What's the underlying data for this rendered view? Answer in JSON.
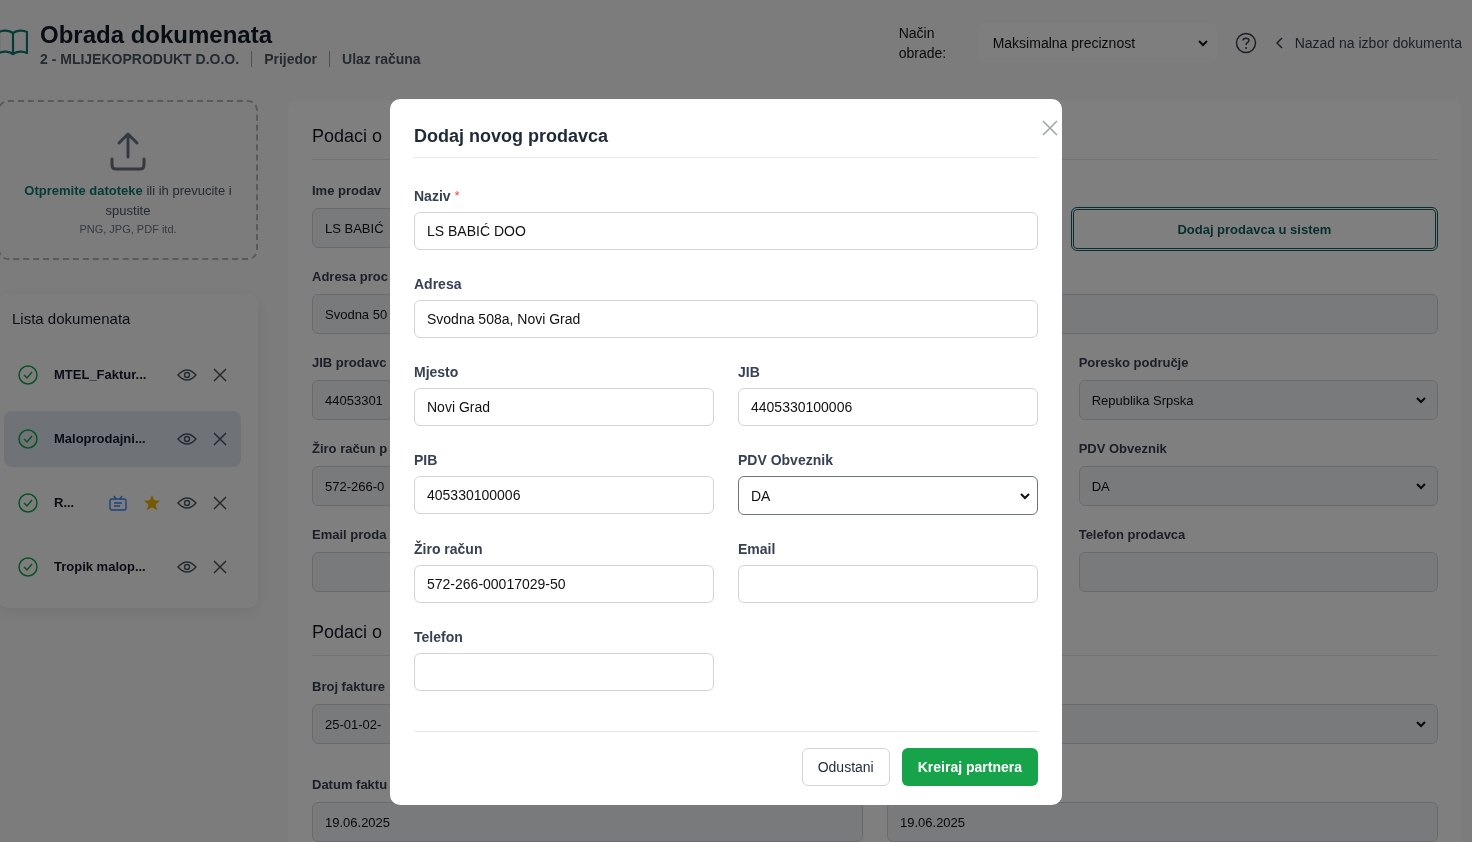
{
  "header": {
    "title": "Obrada dokumenata",
    "breadcrumb": [
      "2 - MLIJEKOPRODUKT D.O.O.",
      "Prijedor",
      "Ulaz računa"
    ],
    "mode_label": "Način obrade:",
    "mode_value": "Maksimalna preciznost",
    "back_link": "Nazad na izbor dokumenta"
  },
  "upload": {
    "link": "Otpremite datoteke",
    "text": "ili ih prevucite i spustite",
    "hint": "PNG, JPG, PDF itd."
  },
  "documents": {
    "title": "Lista dokumenata",
    "items": [
      {
        "name": "MTEL_Faktur...",
        "selected": false,
        "tagged": false,
        "starred": false
      },
      {
        "name": "Maloprodajni...",
        "selected": true,
        "tagged": false,
        "starred": false
      },
      {
        "name": "R...",
        "selected": false,
        "tagged": true,
        "starred": true
      },
      {
        "name": "Tropik malop...",
        "selected": false,
        "tagged": false,
        "starred": false
      }
    ]
  },
  "seller_section": {
    "title": "Podaci o",
    "name_field": {
      "label": "Ime prodav",
      "value": "LS BABIĆ"
    },
    "add_button": "Dodaj prodavca u sistem",
    "address_field": {
      "label": "Adresa proc",
      "value": "Svodna 50"
    },
    "left_fields": [
      {
        "kind": "input",
        "label": "JIB prodavc",
        "value": "44053301"
      },
      {
        "kind": "input",
        "label": "Žiro račun p",
        "value": "572-266-0"
      },
      {
        "kind": "input",
        "label": "Email proda"
      }
    ],
    "right_fields": [
      {
        "kind": "select",
        "label": "Poresko područje",
        "value": "Republika Srpska"
      },
      {
        "kind": "select",
        "label": "PDV Obveznik",
        "value": "DA"
      },
      {
        "kind": "input",
        "label": "Telefon prodavca"
      }
    ]
  },
  "invoice_section": {
    "title": "Podaci o",
    "cells": [
      {
        "kind": "input",
        "label": "Broj fakture",
        "value": "25-01-02-"
      },
      {
        "kind": "select"
      },
      {
        "kind": "input",
        "label": "Datum faktu",
        "value": "19.06.2025"
      },
      {
        "kind": "input",
        "value": "19.06.2025"
      }
    ]
  },
  "modal": {
    "title": "Dodaj novog prodavca",
    "fields": [
      {
        "kind": "input",
        "label": "Naziv",
        "required": true,
        "value": "LS BABIĆ DOO",
        "wide": true
      },
      {
        "kind": "input",
        "label": "Adresa",
        "required": false,
        "value": "Svodna 508a, Novi Grad",
        "wide": true
      },
      {
        "kind": "input",
        "label": "Mjesto",
        "required": false,
        "value": "Novi Grad",
        "wide": false
      },
      {
        "kind": "input",
        "label": "JIB",
        "required": false,
        "value": "4405330100006",
        "wide": false
      },
      {
        "kind": "input",
        "label": "PIB",
        "required": false,
        "value": "405330100006",
        "wide": false
      },
      {
        "kind": "select",
        "label": "PDV Obveznik",
        "required": false,
        "value": "DA",
        "wide": false
      },
      {
        "kind": "input",
        "label": "Žiro račun",
        "required": false,
        "value": "572-266-00017029-50",
        "wide": false
      },
      {
        "kind": "input",
        "label": "Email",
        "required": false,
        "wide": false
      },
      {
        "kind": "input",
        "label": "Telefon",
        "required": false,
        "wide": false
      }
    ],
    "required_mark": "*",
    "cancel": "Odustani",
    "submit": "Kreiraj partnera"
  }
}
